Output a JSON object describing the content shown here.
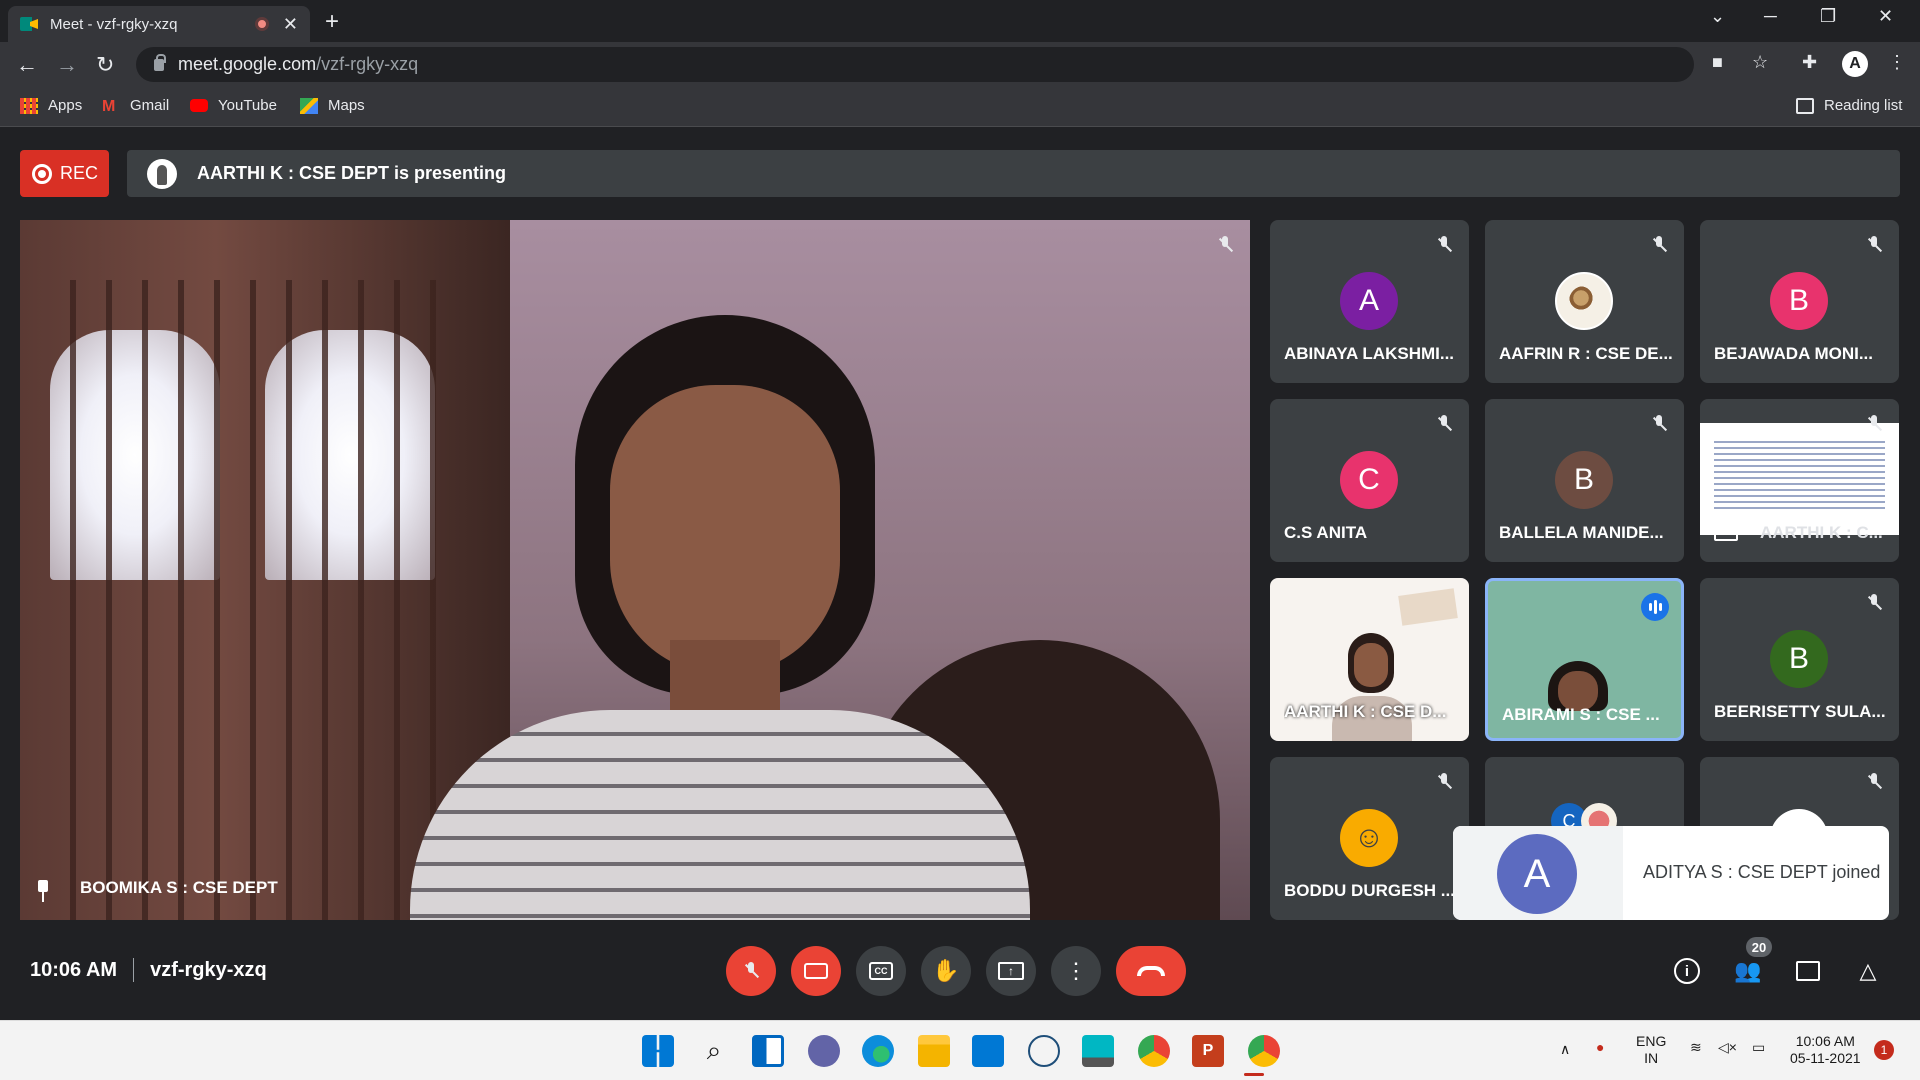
{
  "browser": {
    "tab_title": "Meet - vzf-rgky-xzq",
    "url_host": "meet.google.com",
    "url_path": "/vzf-rgky-xzq",
    "profile_initial": "A",
    "bookmarks": [
      "Apps",
      "Gmail",
      "YouTube",
      "Maps"
    ],
    "reading_list": "Reading list"
  },
  "meet": {
    "rec_label": "REC",
    "presenting_text": "AARTHI K : CSE DEPT is presenting",
    "main_speaker": "BOOMIKA S : CSE DEPT",
    "tiles": [
      {
        "name": "ABINAYA LAKSHMI...",
        "initial": "A",
        "color": "#7b1fa2"
      },
      {
        "name": "AAFRIN R : CSE DE...",
        "initial": "",
        "color": "#f5f0e6"
      },
      {
        "name": "BEJAWADA MONI...",
        "initial": "B",
        "color": "#e8336d"
      },
      {
        "name": "C.S ANITA",
        "initial": "C",
        "color": "#e8336d"
      },
      {
        "name": "BALLELA MANIDE...",
        "initial": "B",
        "color": "#6d4c41"
      },
      {
        "name": "AARTHI K : C...",
        "initial": "",
        "color": "#ffffff"
      },
      {
        "name": "AARTHI K : CSE D...",
        "initial": "",
        "color": "#f7f3ef"
      },
      {
        "name": "ABIRAMI S : CSE ...",
        "initial": "",
        "color": "#7fb6a2"
      },
      {
        "name": "BEERISETTY SULA...",
        "initial": "B",
        "color": "#33691e"
      },
      {
        "name": "BODDU DURGESH ...",
        "initial": "☺",
        "color": "#f9ab00"
      },
      {
        "name": "",
        "initial": "C",
        "color": "#1565c0"
      },
      {
        "name": "",
        "initial": "",
        "color": "#ffffff"
      }
    ],
    "toast_initial": "A",
    "toast_text": "ADITYA S : CSE DEPT joined",
    "toast_color": "#5c6bc0",
    "time": "10:06 AM",
    "meeting_code": "vzf-rgky-xzq",
    "participants_count": "20"
  },
  "taskbar": {
    "lang_top": "ENG",
    "lang_bottom": "IN",
    "clock_time": "10:06 AM",
    "clock_date": "05-11-2021",
    "notification_count": "1"
  }
}
